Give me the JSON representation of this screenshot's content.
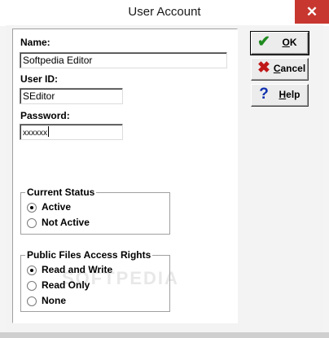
{
  "window": {
    "title": "User Account",
    "close_glyph": "✕"
  },
  "form": {
    "name_label": "Name:",
    "name_value": "Softpedia Editor",
    "userid_label": "User ID:",
    "userid_value": "SEditor",
    "password_label": "Password:",
    "password_value": "xxxxxx"
  },
  "status_group": {
    "title": "Current Status",
    "options": [
      {
        "label": "Active",
        "checked": true
      },
      {
        "label": "Not Active",
        "checked": false
      }
    ]
  },
  "access_group": {
    "title": "Public Files Access Rights",
    "options": [
      {
        "label": "Read and Write",
        "checked": true
      },
      {
        "label": "Read Only",
        "checked": false
      },
      {
        "label": "None",
        "checked": false
      }
    ]
  },
  "buttons": {
    "ok": {
      "icon_glyph": "✔",
      "icon": "check-icon",
      "color": "#1f8a1f",
      "mnemonic": "O",
      "rest": "K"
    },
    "cancel": {
      "icon_glyph": "✖",
      "icon": "x-icon",
      "color": "#c01818",
      "mnemonic": "C",
      "rest": "ancel"
    },
    "help": {
      "icon_glyph": "?",
      "icon": "question-icon",
      "color": "#1030b0",
      "mnemonic": "H",
      "rest": "elp"
    }
  },
  "watermark": "SOFTPEDIA"
}
